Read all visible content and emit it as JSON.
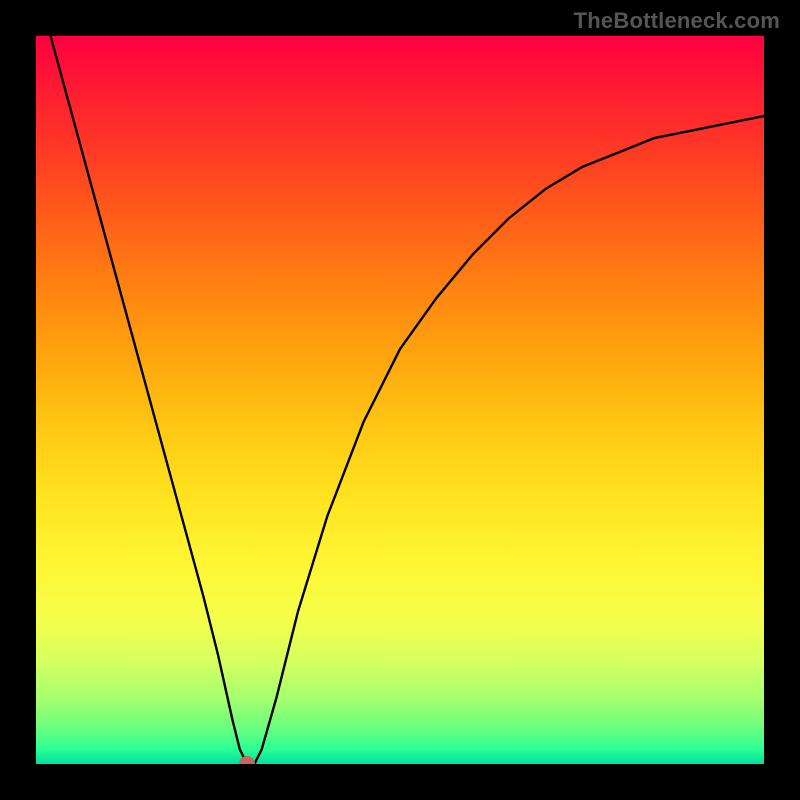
{
  "watermark_text": "TheBottleneck.com",
  "colors": {
    "frame": "#000000",
    "curve": "#000000",
    "optimal_point": "#c8685a",
    "gradient_top": "#ff0040",
    "gradient_bottom": "#00e0a0"
  },
  "chart_data": {
    "type": "line",
    "title": "",
    "xlabel": "",
    "ylabel": "",
    "xlim": [
      0,
      100
    ],
    "ylim": [
      0,
      100
    ],
    "optimal_x": 29,
    "optimal_y": 0,
    "curve_points": [
      {
        "x": 2,
        "y": 100
      },
      {
        "x": 5,
        "y": 89
      },
      {
        "x": 8,
        "y": 78
      },
      {
        "x": 11,
        "y": 67
      },
      {
        "x": 14,
        "y": 56
      },
      {
        "x": 17,
        "y": 45
      },
      {
        "x": 20,
        "y": 34
      },
      {
        "x": 23,
        "y": 23
      },
      {
        "x": 25,
        "y": 15
      },
      {
        "x": 27,
        "y": 6
      },
      {
        "x": 28,
        "y": 2
      },
      {
        "x": 29,
        "y": 0
      },
      {
        "x": 30,
        "y": 0
      },
      {
        "x": 31,
        "y": 2
      },
      {
        "x": 33,
        "y": 9
      },
      {
        "x": 36,
        "y": 21
      },
      {
        "x": 40,
        "y": 34
      },
      {
        "x": 45,
        "y": 47
      },
      {
        "x": 50,
        "y": 57
      },
      {
        "x": 55,
        "y": 64
      },
      {
        "x": 60,
        "y": 70
      },
      {
        "x": 65,
        "y": 75
      },
      {
        "x": 70,
        "y": 79
      },
      {
        "x": 75,
        "y": 82
      },
      {
        "x": 80,
        "y": 84
      },
      {
        "x": 85,
        "y": 86
      },
      {
        "x": 90,
        "y": 87
      },
      {
        "x": 95,
        "y": 88
      },
      {
        "x": 100,
        "y": 89
      }
    ]
  }
}
